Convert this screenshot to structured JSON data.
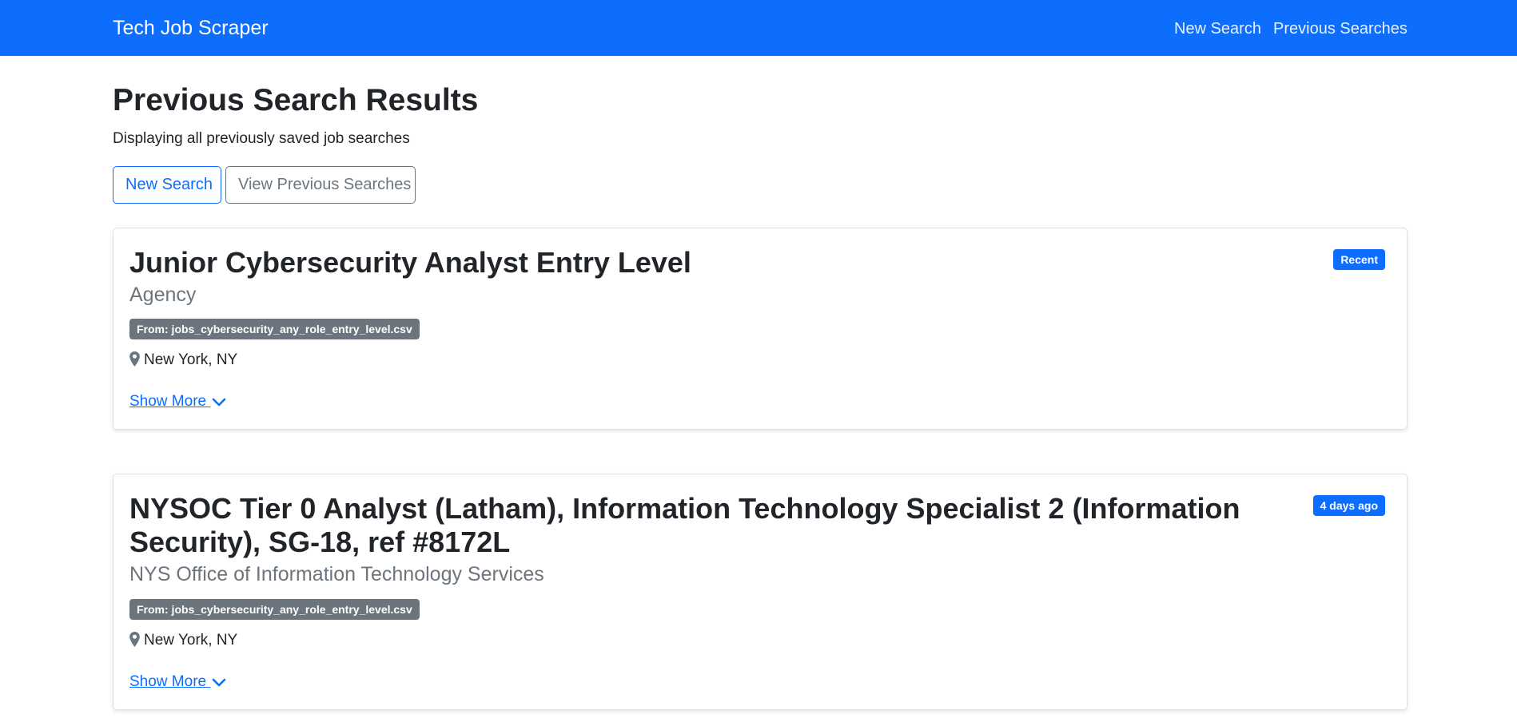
{
  "navbar": {
    "brand": "Tech Job Scraper",
    "links": [
      {
        "label": "New Search"
      },
      {
        "label": "Previous Searches"
      }
    ],
    "background_color": "#0d6efd"
  },
  "page": {
    "title": "Previous Search Results",
    "subtitle": "Displaying all previously saved job searches"
  },
  "actions": {
    "new_search_label": "New Search",
    "view_previous_label": "View Previous Searches"
  },
  "jobs": [
    {
      "title": "Junior Cybersecurity Analyst Entry Level",
      "company": "Agency",
      "source": "From: jobs_cybersecurity_any_role_entry_level.csv",
      "location": "New York, NY",
      "date_badge": "Recent",
      "show_more_label": "Show More"
    },
    {
      "title": "NYSOC Tier 0 Analyst (Latham), Information Technology Specialist 2 (Information Security), SG-18, ref #8172L",
      "company": "NYS Office of Information Technology Services",
      "source": "From: jobs_cybersecurity_any_role_entry_level.csv",
      "location": "New York, NY",
      "date_badge": "4 days ago",
      "show_more_label": "Show More"
    }
  ],
  "icons": {
    "location": "map-pin-icon",
    "show_more": "chevron-down-icon"
  },
  "colors": {
    "primary": "#0d6efd",
    "secondary": "#6c757d",
    "text": "#212529"
  }
}
